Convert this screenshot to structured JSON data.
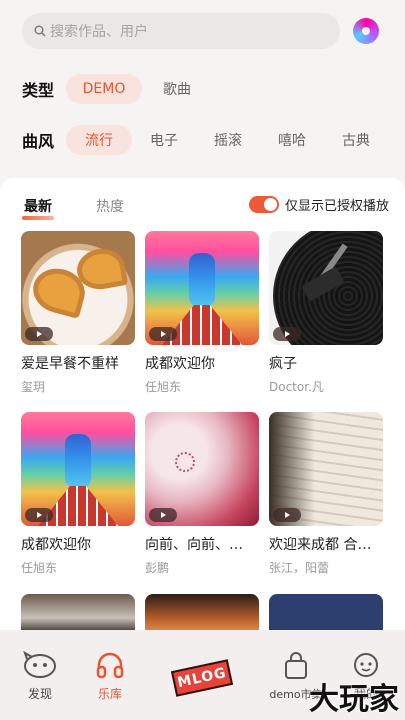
{
  "search": {
    "placeholder": "搜索作品、用户"
  },
  "filters": {
    "type": {
      "label": "类型",
      "options": [
        "DEMO",
        "歌曲"
      ],
      "selected": "DEMO"
    },
    "genre": {
      "label": "曲风",
      "options": [
        "流行",
        "电子",
        "摇滚",
        "嘻哈",
        "古典"
      ],
      "selected": "流行"
    }
  },
  "sort": {
    "tabs": [
      "最新",
      "热度"
    ],
    "selected": "最新"
  },
  "licensed_toggle": {
    "label": "仅显示已授权播放",
    "on": true
  },
  "items": [
    {
      "title": "爱是早餐不重样",
      "artist": "玺玥"
    },
    {
      "title": "成都欢迎你",
      "artist": "任旭东"
    },
    {
      "title": "疯子",
      "artist": "Doctor.凡"
    },
    {
      "title": "成都欢迎你",
      "artist": "任旭东"
    },
    {
      "title": "向前、向前、…",
      "artist": "彭鹏"
    },
    {
      "title": "欢迎来成都 合…",
      "artist": "张江，阳蕾"
    }
  ],
  "nav": {
    "items": [
      {
        "label": "发现",
        "icon": "discover-face-icon"
      },
      {
        "label": "乐库",
        "icon": "headphones-icon",
        "active": true
      },
      {
        "label": "MLOG",
        "icon": "mlog-badge"
      },
      {
        "label": "demo市集",
        "icon": "shopping-bag-icon"
      },
      {
        "label": "我的",
        "icon": "profile-face-icon"
      }
    ]
  },
  "watermark": "大玩家",
  "colors": {
    "accent": "#e9542f",
    "chip_bg": "#f9e3de",
    "toggle": "#ec5a3a"
  }
}
